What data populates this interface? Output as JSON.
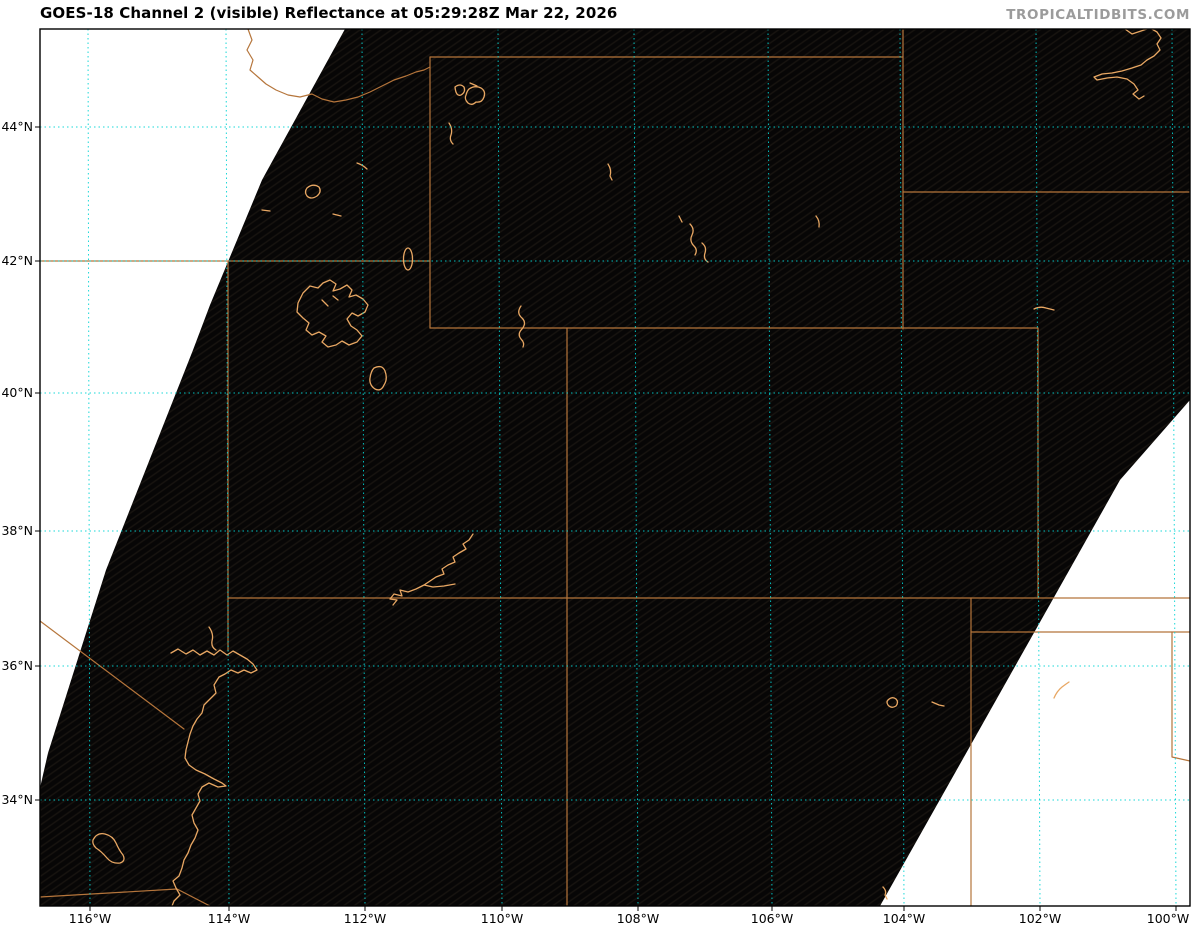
{
  "header": {
    "title": "GOES-18 Channel 2 (visible) Reflectance at 05:29:28Z Mar 22, 2026",
    "watermark": "TROPICALTIDBITS.COM"
  },
  "axes": {
    "x_labels": [
      "116°W",
      "114°W",
      "112°W",
      "110°W",
      "108°W",
      "106°W",
      "104°W",
      "102°W",
      "100°W"
    ],
    "y_labels": [
      "44°N",
      "42°N",
      "40°N",
      "38°N",
      "36°N",
      "34°N"
    ]
  },
  "colors": {
    "state-border": "#b5753b",
    "water": "#e8a763",
    "grid": "#00d4d4",
    "watermark": "#9b9b9b",
    "map-bg": "#070606"
  }
}
